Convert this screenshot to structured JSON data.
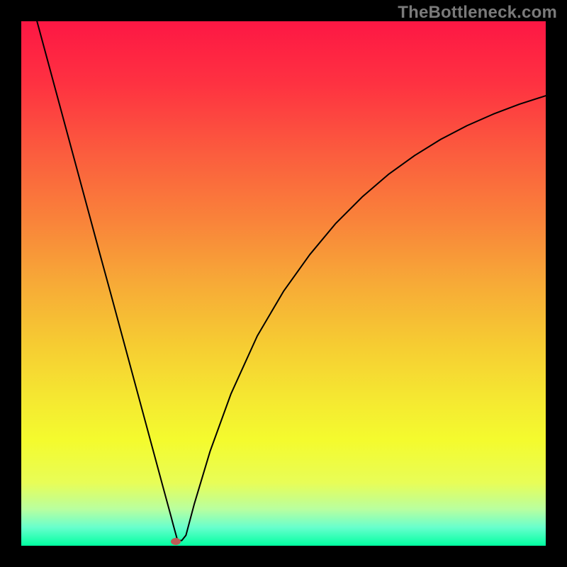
{
  "watermark": {
    "text": "TheBottleneck.com"
  },
  "chart_data": {
    "type": "line",
    "title": "",
    "xlabel": "",
    "ylabel": "",
    "xlim": [
      0,
      100
    ],
    "ylim": [
      0,
      100
    ],
    "grid": false,
    "legend": false,
    "background_gradient": {
      "type": "linear-vertical",
      "stops": [
        {
          "pos": 0.0,
          "color": "#fd1744"
        },
        {
          "pos": 0.12,
          "color": "#fe3241"
        },
        {
          "pos": 0.25,
          "color": "#fb5c3e"
        },
        {
          "pos": 0.38,
          "color": "#f9833a"
        },
        {
          "pos": 0.5,
          "color": "#f7aa37"
        },
        {
          "pos": 0.62,
          "color": "#f6cd32"
        },
        {
          "pos": 0.72,
          "color": "#f5e831"
        },
        {
          "pos": 0.8,
          "color": "#f4fb2e"
        },
        {
          "pos": 0.88,
          "color": "#e8fd57"
        },
        {
          "pos": 0.93,
          "color": "#b9ff9f"
        },
        {
          "pos": 0.965,
          "color": "#68ffcd"
        },
        {
          "pos": 1.0,
          "color": "#01ffa1"
        }
      ]
    },
    "series": [
      {
        "name": "bottleneck-curve",
        "color": "#000000",
        "stroke_width": 2,
        "x": [
          3,
          5,
          7,
          9,
          11,
          13,
          15,
          17,
          19,
          21,
          23,
          25,
          27,
          28.5,
          29,
          29.8,
          30.6,
          31.4,
          33,
          36,
          40,
          45,
          50,
          55,
          60,
          65,
          70,
          75,
          80,
          85,
          90,
          95,
          100
        ],
        "y": [
          100,
          92.6,
          85.2,
          77.8,
          70.4,
          63.0,
          55.6,
          48.3,
          40.9,
          33.5,
          26.1,
          18.7,
          11.3,
          5.8,
          3.9,
          1.0,
          1.0,
          2.0,
          8.0,
          18.0,
          29.0,
          40.0,
          48.5,
          55.5,
          61.5,
          66.5,
          70.8,
          74.4,
          77.5,
          80.1,
          82.3,
          84.2,
          85.8
        ]
      }
    ],
    "marker": {
      "x": 29.5,
      "y": 0.8,
      "color": "#be5b57"
    }
  }
}
